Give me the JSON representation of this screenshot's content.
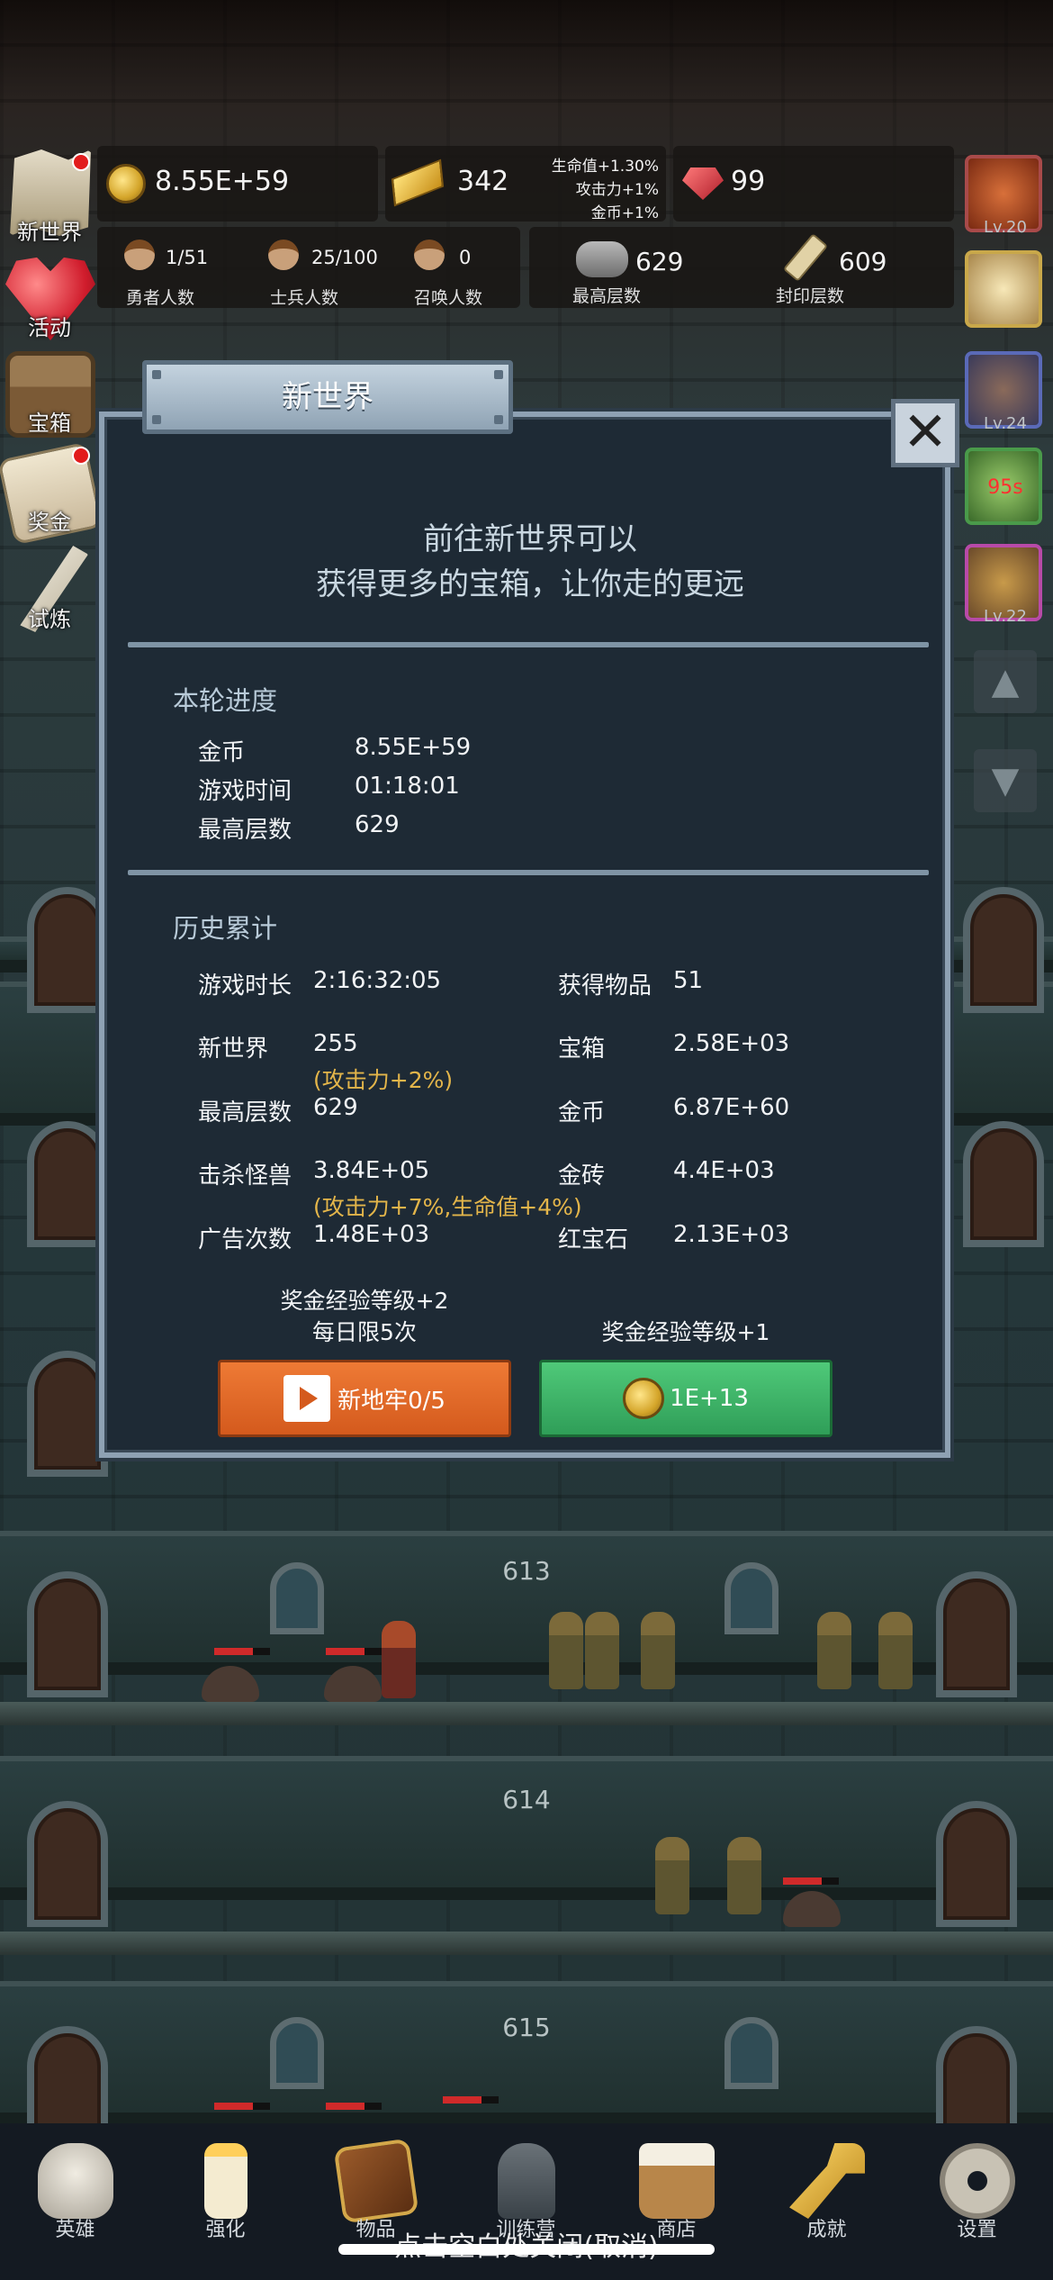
{
  "resources": {
    "gold": "8.55E+59",
    "gold_bars": "342",
    "bonus_lines": [
      "生命值+1.30%",
      "攻击力+1%",
      "金币+1%"
    ],
    "rubies": "99"
  },
  "counts": {
    "heroes": {
      "value": "1/51",
      "label": "勇者人数"
    },
    "soldiers": {
      "value": "25/100",
      "label": "士兵人数"
    },
    "summons": {
      "value": "0",
      "label": "召唤人数"
    },
    "max_floor": {
      "value": "629",
      "label": "最高层数"
    },
    "sealed_floor": {
      "value": "609",
      "label": "封印层数"
    }
  },
  "left_menu": [
    {
      "label": "新世界",
      "icon": "map-icon",
      "badge": true
    },
    {
      "label": "活动",
      "icon": "heart-icon",
      "badge": false
    },
    {
      "label": "宝箱",
      "icon": "chest-icon",
      "badge": false
    },
    {
      "label": "奖金",
      "icon": "envelope-icon",
      "badge": true
    },
    {
      "label": "试炼",
      "icon": "feather-icon",
      "badge": false
    }
  ],
  "right_slots": {
    "timer": "95s",
    "labels": [
      "Lv.20",
      "Lv.24",
      "Lv.22"
    ]
  },
  "dialog": {
    "title": "新世界",
    "description_line1": "前往新世界可以",
    "description_line2": "获得更多的宝箱，让你走的更远",
    "current_round": {
      "title": "本轮进度",
      "rows": [
        {
          "label": "金币",
          "value": "8.55E+59"
        },
        {
          "label": "游戏时间",
          "value": "01:18:01"
        },
        {
          "label": "最高层数",
          "value": "629"
        }
      ]
    },
    "history": {
      "title": "历史累计",
      "left": [
        {
          "label": "游戏时长",
          "value": "2:16:32:05"
        },
        {
          "label": "新世界",
          "value": "255",
          "bonus": "(攻击力+2%)"
        },
        {
          "label": "最高层数",
          "value": "629"
        },
        {
          "label": "击杀怪兽",
          "value": "3.84E+05",
          "bonus": "(攻击力+7%,生命值+4%)"
        },
        {
          "label": "广告次数",
          "value": "1.48E+03"
        }
      ],
      "right": [
        {
          "label": "获得物品",
          "value": "51"
        },
        {
          "label": "宝箱",
          "value": "2.58E+03"
        },
        {
          "label": "金币",
          "value": "6.87E+60"
        },
        {
          "label": "金砖",
          "value": "4.4E+03"
        },
        {
          "label": "红宝石",
          "value": "2.13E+03"
        }
      ]
    },
    "left_button": {
      "note_line1": "奖金经验等级+2",
      "note_line2": "每日限5次",
      "label": "新地牢0/5"
    },
    "right_button": {
      "note": "奖金经验等级+1",
      "label": "1E+13"
    }
  },
  "floors": [
    "613",
    "614",
    "615"
  ],
  "bottom_nav": [
    {
      "label": "英雄",
      "icon": "skull-icon"
    },
    {
      "label": "强化",
      "icon": "candle-icon"
    },
    {
      "label": "物品",
      "icon": "book-icon"
    },
    {
      "label": "训练营",
      "icon": "lantern-icon"
    },
    {
      "label": "商店",
      "icon": "mug-icon"
    },
    {
      "label": "成就",
      "icon": "key-icon"
    },
    {
      "label": "设置",
      "icon": "gear-icon"
    }
  ],
  "hint": "点击空白处关闭(取消)"
}
